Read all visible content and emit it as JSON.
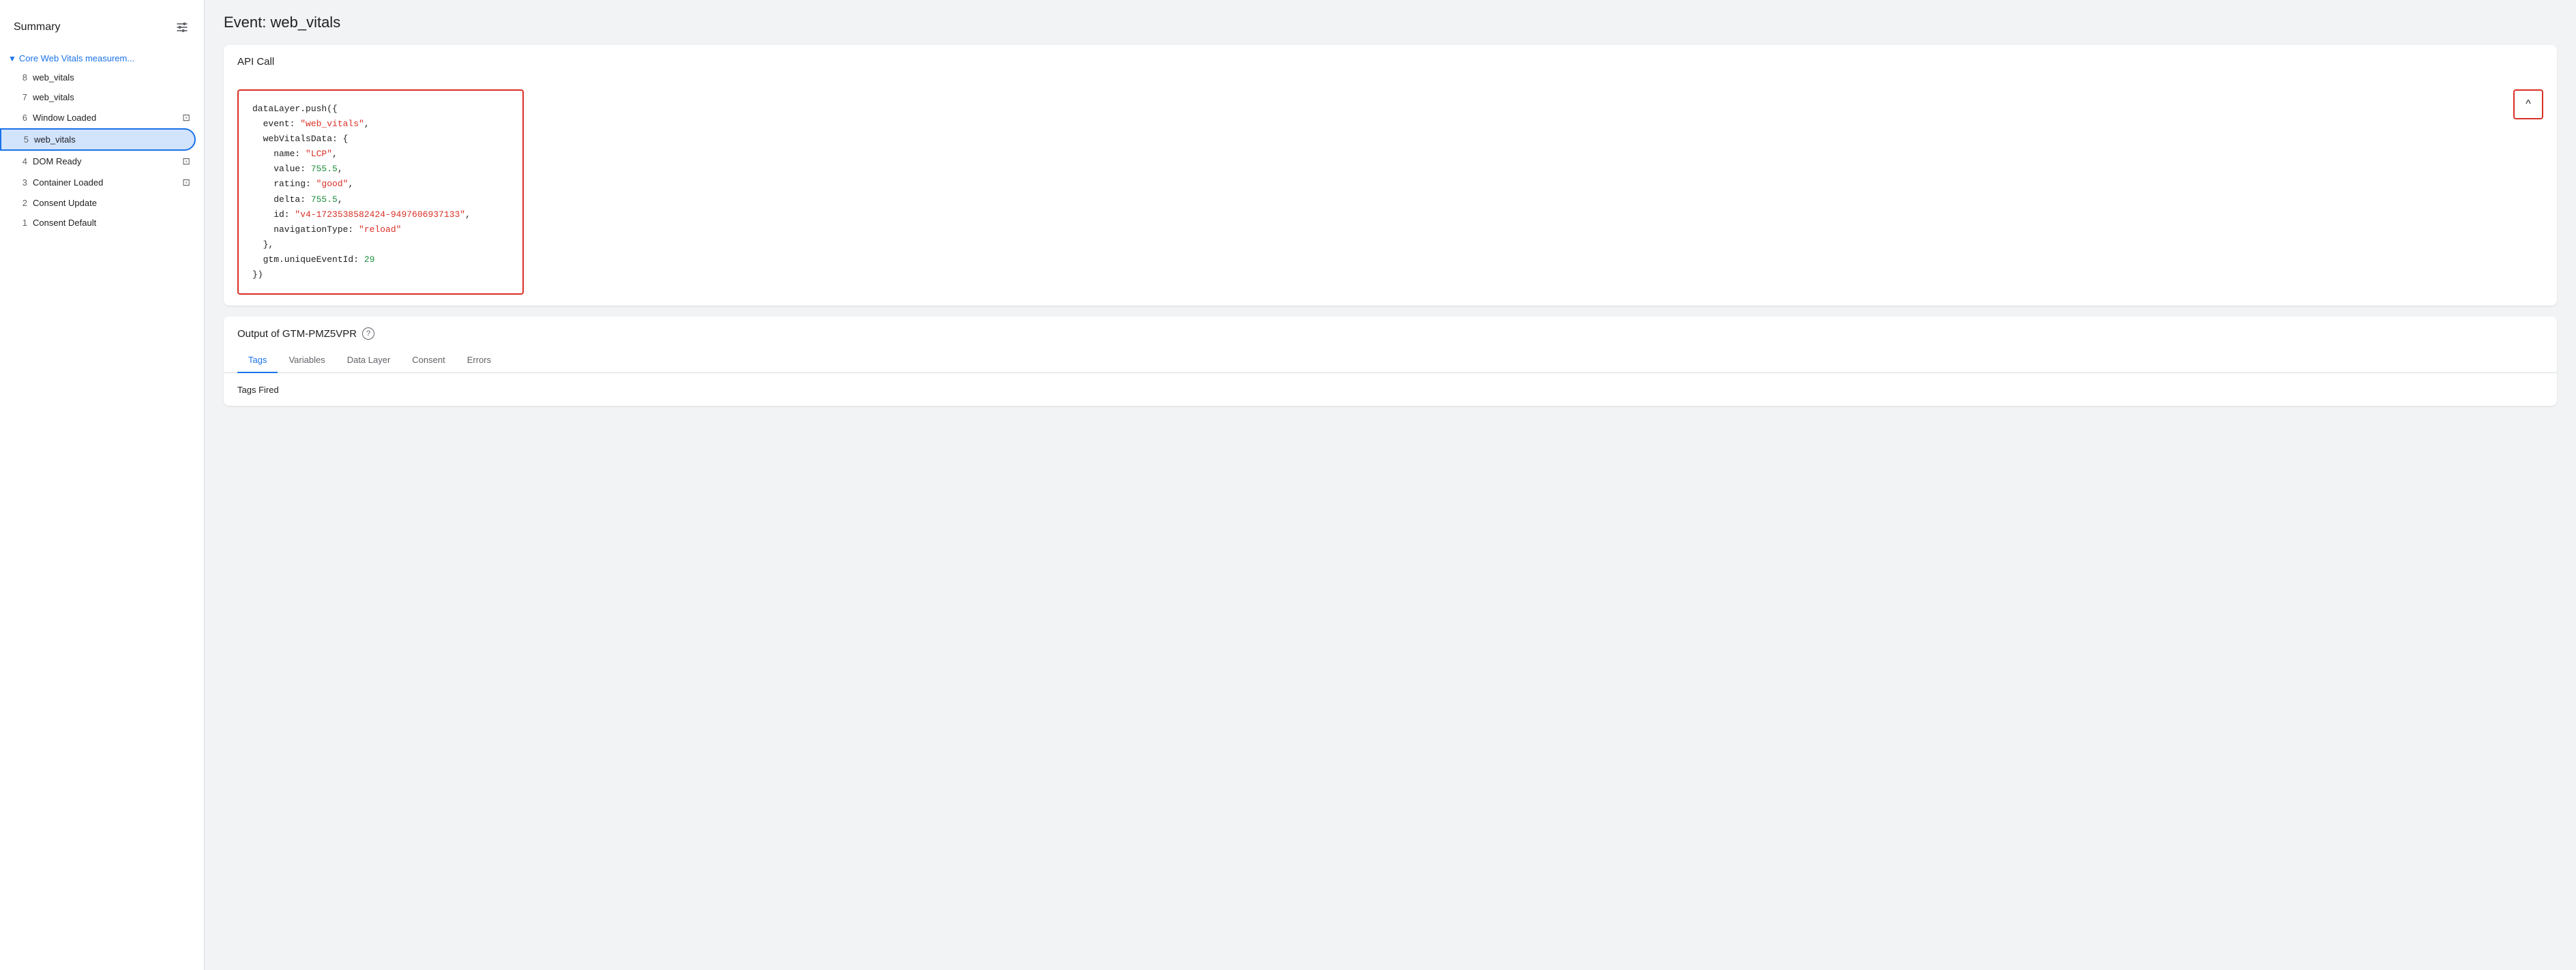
{
  "sidebar": {
    "title": "Summary",
    "icons": {
      "filter": "⊟",
      "list": "☰"
    },
    "group": {
      "label": "Core Web Vitals measurem...",
      "chevron": "▼"
    },
    "items": [
      {
        "number": "8",
        "label": "web_vitals",
        "icon": null,
        "active": false
      },
      {
        "number": "7",
        "label": "web_vitals",
        "icon": null,
        "active": false
      },
      {
        "number": "6",
        "label": "Window Loaded",
        "icon": "◧",
        "active": false
      },
      {
        "number": "5",
        "label": "web_vitals",
        "icon": null,
        "active": true
      },
      {
        "number": "4",
        "label": "DOM Ready",
        "icon": "◧",
        "active": false
      },
      {
        "number": "3",
        "label": "Container Loaded",
        "icon": "◧",
        "active": false
      },
      {
        "number": "2",
        "label": "Consent Update",
        "icon": null,
        "active": false
      },
      {
        "number": "1",
        "label": "Consent Default",
        "icon": null,
        "active": false
      }
    ]
  },
  "page_title": "Event: web_vitals",
  "api_call": {
    "section_label": "API Call",
    "code": {
      "line1": "dataLayer.push({",
      "line2_key": "  event: ",
      "line2_val": "\"web_vitals\"",
      "line3": "  webVitalsData: {",
      "line4_key": "    name: ",
      "line4_val": "\"LCP\"",
      "line5_key": "    value: ",
      "line5_val": "755.5",
      "line6_key": "    rating: ",
      "line6_val": "\"good\"",
      "line7_key": "    delta: ",
      "line7_val": "755.5",
      "line8_key": "    id: ",
      "line8_val": "\"v4-1723538582424-9497606937133\"",
      "line9_key": "    navigationType: ",
      "line9_val": "\"reload\"",
      "line10": "  },",
      "line11_key": "  gtm.uniqueEventId: ",
      "line11_val": "29",
      "line12": "})"
    },
    "collapse_icon": "^"
  },
  "output": {
    "title": "Output of GTM-PMZ5VPR",
    "help_icon": "?",
    "tabs": [
      {
        "label": "Tags",
        "active": true
      },
      {
        "label": "Variables",
        "active": false
      },
      {
        "label": "Data Layer",
        "active": false
      },
      {
        "label": "Consent",
        "active": false
      },
      {
        "label": "Errors",
        "active": false
      }
    ],
    "tags_fired_label": "Tags Fired"
  }
}
